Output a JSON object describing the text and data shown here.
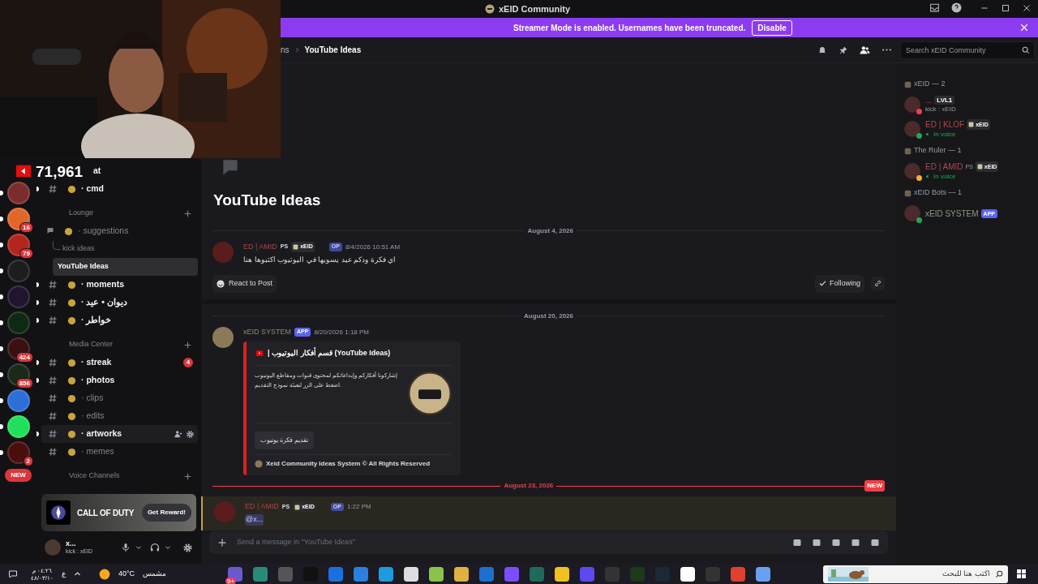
{
  "window": {
    "title": "xEID Community"
  },
  "banner": {
    "text": "Streamer Mode is enabled. Usernames have been truncated.",
    "button": "Disable"
  },
  "stream_overlay": {
    "viewers": "71,961"
  },
  "servers": [
    {
      "unread": true
    },
    {
      "unread": true,
      "badge": "16"
    },
    {
      "unread": true,
      "badge": "79"
    },
    {
      "unread": true
    },
    {
      "unread": true
    },
    {
      "unread": true
    },
    {
      "unread": true,
      "badge": "424"
    },
    {
      "unread": true,
      "badge": "856"
    },
    {
      "unread": true
    },
    {
      "unread": true
    },
    {
      "unread": true,
      "badge": "2"
    }
  ],
  "new_label": "NEW",
  "channels": [
    {
      "kind": "text",
      "name": "at",
      "unread": true,
      "selected": false,
      "hovered": false
    },
    {
      "kind": "text",
      "name": "· cmd",
      "unread": true,
      "selected": false,
      "hovered": false
    },
    {
      "kind": "category",
      "name": "Lounge"
    },
    {
      "kind": "forum",
      "name": "· suggestions",
      "unread": false,
      "selected": false,
      "hovered": false
    },
    {
      "kind": "thread",
      "name": "kick ideas",
      "unread": false,
      "selected": false,
      "hovered": false
    },
    {
      "kind": "thread",
      "name": "YouTube Ideas",
      "unread": false,
      "selected": true,
      "hovered": false
    },
    {
      "kind": "text",
      "name": "· moments",
      "unread": true,
      "selected": false,
      "hovered": false
    },
    {
      "kind": "text",
      "name": "· ديوان • عيد",
      "unread": true,
      "selected": false,
      "hovered": false
    },
    {
      "kind": "text",
      "name": "· خواطر",
      "unread": true,
      "selected": false,
      "hovered": false
    },
    {
      "kind": "category",
      "name": "Media Center"
    },
    {
      "kind": "text",
      "name": "· streak",
      "unread": true,
      "selected": false,
      "hovered": false,
      "mentions": "4"
    },
    {
      "kind": "text",
      "name": "· photos",
      "unread": true,
      "selected": false,
      "hovered": false
    },
    {
      "kind": "text",
      "name": "· clips",
      "unread": false,
      "selected": false,
      "hovered": false
    },
    {
      "kind": "text",
      "name": "· edits",
      "unread": false,
      "selected": false,
      "hovered": false
    },
    {
      "kind": "text",
      "name": "· artworks",
      "unread": true,
      "selected": false,
      "hovered": true
    },
    {
      "kind": "text",
      "name": "· memes",
      "unread": false,
      "selected": false,
      "hovered": false
    },
    {
      "kind": "category",
      "name": "Voice Channels"
    }
  ],
  "promo": {
    "logo": "CALL OF DUTY",
    "button": "Get Reward!"
  },
  "user_panel": {
    "name": "x...",
    "status": "kick : xEID"
  },
  "header": {
    "breadcrumb_parent": "ns",
    "breadcrumb_current": "YouTube Ideas",
    "search": {
      "placeholder": "Search xEID Community"
    }
  },
  "thread": {
    "title": "YouTube Ideas",
    "react_button": "React to Post",
    "follow_button": "Following"
  },
  "messages": [
    {
      "kind": "divider",
      "text": "August 4, 2026",
      "is_new": false
    },
    {
      "kind": "post",
      "author": "ED | AMID",
      "tags": [
        "PS"
      ],
      "role_tag": "xEID",
      "badge": "OP",
      "time": "8/4/2026 10:51 AM",
      "text": "اي فكرة ودكم عيد يسويها في اليوتيوب اكتبوها هنا",
      "highlighted": false
    },
    {
      "kind": "divider",
      "text": "August 20, 2026",
      "is_new": false
    },
    {
      "kind": "embed",
      "author": "xEID SYSTEM",
      "badge": "APP",
      "time": "8/20/2026 1:18 PM",
      "embed": {
        "title": "| قسم أفكار اليوتيوب (YouTube Ideas)",
        "lines": [
          "إشاركونا أفكاركم وإبداعاتكم لمحتوى قنوات ومقاطع اليوتيوب",
          "اضغط على الزر لتعبئة نموذج التقديم."
        ],
        "button": "تقديم فكرة يوتيوب",
        "footer": "Xeid Community Ideas System © All Rights Reserved"
      }
    },
    {
      "kind": "divider",
      "text": "August 23, 2026",
      "is_new": true,
      "new_label": "NEW"
    },
    {
      "kind": "post",
      "author": "ED | AMID",
      "tags": [
        "PS"
      ],
      "role_tag": "xEID",
      "badge": "OP",
      "time": "1:22 PM",
      "text": "@x...",
      "highlighted": true
    }
  ],
  "composer": {
    "placeholder": "Send a message in \"YouTube Ideas\""
  },
  "members": [
    {
      "kind": "group",
      "name": "xEID — 2"
    },
    {
      "kind": "member",
      "name": "...",
      "tag": "LVL1",
      "sub": "kick : xEID",
      "color": "#f23f43",
      "voice": false
    },
    {
      "kind": "member",
      "name": "ED | KLOF",
      "tag": "xEID",
      "sub": "In voice",
      "color": "#23a55a",
      "voice": true
    },
    {
      "kind": "group",
      "name": "The Ruler — 1"
    },
    {
      "kind": "member",
      "name": "ED | AMID",
      "tag": "xEID",
      "prefix": "PS",
      "sub": "In voice",
      "color": "#f0b232",
      "voice": true
    },
    {
      "kind": "group",
      "name": "xEID Bots — 1"
    },
    {
      "kind": "member",
      "name": "xEID SYSTEM",
      "app": "APP",
      "color": "#23a55a"
    }
  ],
  "taskbar": {
    "time": "٠٤:٢٦ م",
    "date": "٤٨/٠٣/١٠",
    "language": "ع",
    "temperature": "40°C",
    "weather": "مشمس",
    "app_badge": "9+",
    "search_placeholder": "اكتب هنا للبحث"
  }
}
